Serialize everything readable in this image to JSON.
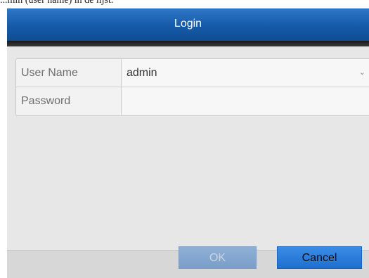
{
  "caption": "...min (user name) in de lijst.",
  "dialog": {
    "title": "Login",
    "fields": [
      {
        "label": "User Name",
        "value": "admin"
      },
      {
        "label": "Password",
        "value": ""
      }
    ],
    "buttons": {
      "ok": "OK",
      "cancel": "Cancel"
    },
    "dropdown_icon": "chevron-down-icon"
  },
  "colors": {
    "title_bar": "#155aa8",
    "dialog_bg": "#e7e7e7",
    "cancel_button": "#1f6fd0",
    "ok_button_disabled": "#7a9ec9"
  }
}
